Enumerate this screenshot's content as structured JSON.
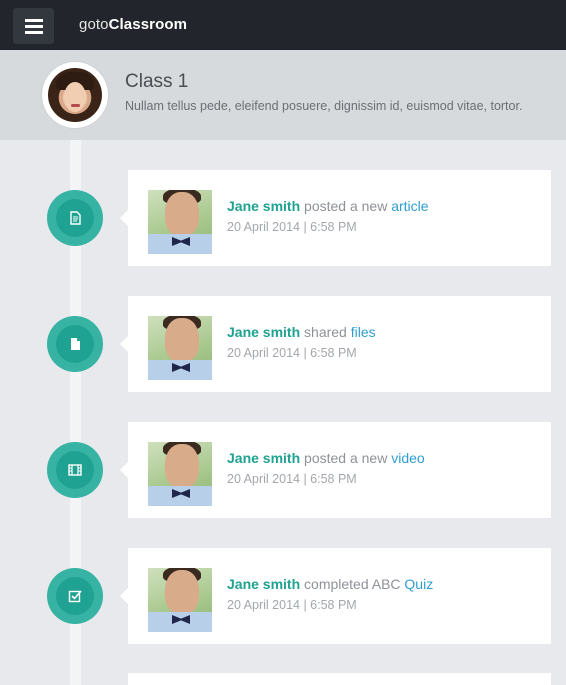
{
  "app": {
    "brand_light": "goto",
    "brand_bold": "Classroom"
  },
  "class": {
    "title": "Class 1",
    "description": "Nullam tellus pede, eleifend posuere, dignissim id, euismod vitae, tortor."
  },
  "colors": {
    "accent": "#1fa291",
    "link": "#2f9fd0",
    "topbar": "#22252b"
  },
  "feed": [
    {
      "icon": "document-icon",
      "author": "Jane smith",
      "action": "posted a new",
      "target": "article",
      "time": "20 April 2014 | 6:58 PM"
    },
    {
      "icon": "file-icon",
      "author": "Jane smith",
      "action": "shared",
      "target": "files",
      "time": "20 April 2014 | 6:58 PM"
    },
    {
      "icon": "film-icon",
      "author": "Jane smith",
      "action": "posted a new",
      "target": "video",
      "time": "20 April 2014 | 6:58 PM"
    },
    {
      "icon": "checkbox-icon",
      "author": "Jane smith",
      "action": "completed ABC",
      "target": "Quiz",
      "time": "20 April 2014 | 6:58 PM"
    }
  ]
}
